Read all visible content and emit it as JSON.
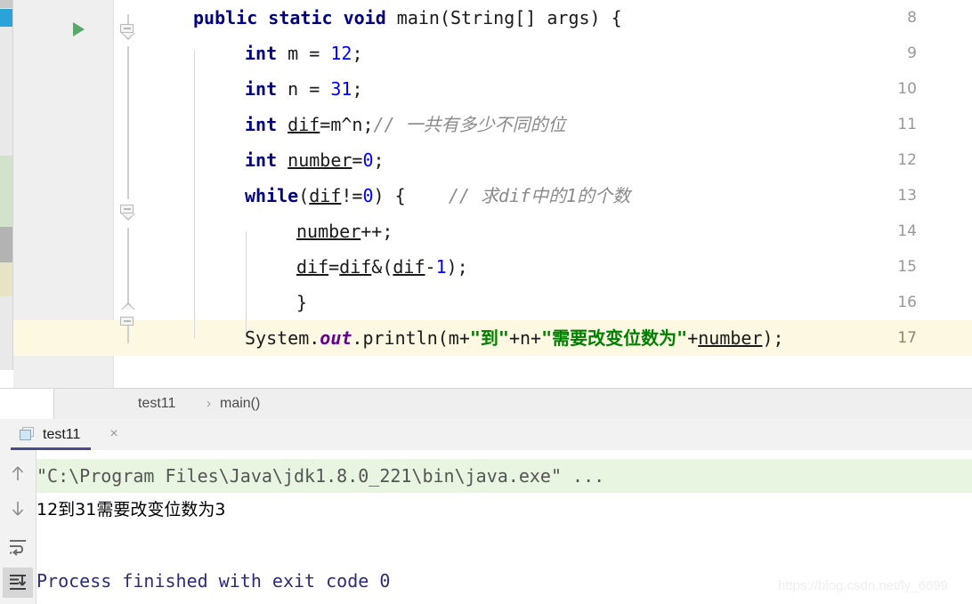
{
  "editor": {
    "lines": [
      {
        "number": "8",
        "tokens": [
          {
            "t": "kw",
            "v": "public"
          },
          {
            "t": "plain",
            "v": " "
          },
          {
            "t": "kw",
            "v": "static"
          },
          {
            "t": "plain",
            "v": " "
          },
          {
            "t": "kw",
            "v": "void"
          },
          {
            "t": "plain",
            "v": " main(String[] args) {"
          }
        ],
        "indent": 0,
        "highlight": false
      },
      {
        "number": "9",
        "tokens": [
          {
            "t": "kw",
            "v": "int"
          },
          {
            "t": "plain",
            "v": " m = "
          },
          {
            "t": "num",
            "v": "12"
          },
          {
            "t": "plain",
            "v": ";"
          }
        ],
        "indent": 1,
        "highlight": false
      },
      {
        "number": "10",
        "tokens": [
          {
            "t": "kw",
            "v": "int"
          },
          {
            "t": "plain",
            "v": " n = "
          },
          {
            "t": "num",
            "v": "31"
          },
          {
            "t": "plain",
            "v": ";"
          }
        ],
        "indent": 1,
        "highlight": false
      },
      {
        "number": "11",
        "tokens": [
          {
            "t": "kw",
            "v": "int"
          },
          {
            "t": "plain",
            "v": " "
          },
          {
            "t": "var",
            "v": "dif"
          },
          {
            "t": "plain",
            "v": "=m^n;"
          },
          {
            "t": "cmt",
            "v": "// 一共有多少不同的位"
          }
        ],
        "indent": 1,
        "highlight": false
      },
      {
        "number": "12",
        "tokens": [
          {
            "t": "kw",
            "v": "int"
          },
          {
            "t": "plain",
            "v": " "
          },
          {
            "t": "var",
            "v": "number"
          },
          {
            "t": "plain",
            "v": "="
          },
          {
            "t": "num",
            "v": "0"
          },
          {
            "t": "plain",
            "v": ";"
          }
        ],
        "indent": 1,
        "highlight": false
      },
      {
        "number": "13",
        "tokens": [
          {
            "t": "kw",
            "v": "while"
          },
          {
            "t": "plain",
            "v": "("
          },
          {
            "t": "var",
            "v": "dif"
          },
          {
            "t": "plain",
            "v": "!="
          },
          {
            "t": "num",
            "v": "0"
          },
          {
            "t": "plain",
            "v": ") {    "
          },
          {
            "t": "cmt",
            "v": "// 求dif中的1的个数"
          }
        ],
        "indent": 1,
        "highlight": false
      },
      {
        "number": "14",
        "tokens": [
          {
            "t": "var",
            "v": "number"
          },
          {
            "t": "plain",
            "v": "++;"
          }
        ],
        "indent": 2,
        "highlight": false
      },
      {
        "number": "15",
        "tokens": [
          {
            "t": "var",
            "v": "dif"
          },
          {
            "t": "plain",
            "v": "="
          },
          {
            "t": "var",
            "v": "dif"
          },
          {
            "t": "plain",
            "v": "&("
          },
          {
            "t": "var",
            "v": "dif"
          },
          {
            "t": "plain",
            "v": "-"
          },
          {
            "t": "num",
            "v": "1"
          },
          {
            "t": "plain",
            "v": ");"
          }
        ],
        "indent": 2,
        "highlight": false
      },
      {
        "number": "16",
        "tokens": [
          {
            "t": "plain",
            "v": "}"
          }
        ],
        "indent": 2,
        "highlight": false
      },
      {
        "number": "17",
        "tokens": [
          {
            "t": "plain",
            "v": "System."
          },
          {
            "t": "fld",
            "v": "out"
          },
          {
            "t": "plain",
            "v": ".println(m+"
          },
          {
            "t": "str",
            "v": "\"到\""
          },
          {
            "t": "plain",
            "v": "+n+"
          },
          {
            "t": "str",
            "v": "\"需要改变位数为\""
          },
          {
            "t": "plain",
            "v": "+"
          },
          {
            "t": "var",
            "v": "number"
          },
          {
            "t": "plain",
            "v": ");"
          }
        ],
        "indent": 1,
        "highlight": true
      }
    ],
    "run_arrow_icon": "run-play-icon",
    "fold_icons": [
      "fold-collapse-icon",
      "fold-collapse-icon",
      "fold-end-icon"
    ]
  },
  "breadcrumb": {
    "items": [
      "test11",
      "main()"
    ],
    "separator": "›"
  },
  "run_window": {
    "tab": {
      "label": "test11",
      "icon": "run-configuration-icon",
      "close": "×"
    },
    "toolbar": [
      {
        "name": "up-arrow-icon",
        "glyph": "↑",
        "active": false
      },
      {
        "name": "down-arrow-icon",
        "glyph": "↓",
        "active": false
      },
      {
        "name": "soft-wrap-icon",
        "glyph": "⏎",
        "active": false
      },
      {
        "name": "scroll-to-end-icon",
        "glyph": "⇟",
        "active": true
      }
    ],
    "console": {
      "command_line": "\"C:\\Program Files\\Java\\jdk1.8.0_221\\bin\\java.exe\" ...",
      "output_line": "12到31需要改变位数为3",
      "blank_line": "",
      "finished_line": "Process finished with exit code 0"
    }
  },
  "watermark": "https://blog.csdn.net/ly_6699",
  "colors": {
    "keyword": "#000080",
    "number": "#0000ff",
    "string": "#008000",
    "comment": "#8a8a8a",
    "field": "#660099",
    "line_highlight": "#fdf8e2",
    "console_cmd_bg": "#e8f5e1",
    "finished_text": "#2b2b7a",
    "run_arrow": "#59a869",
    "tab_underline": "#4a4a8f"
  }
}
